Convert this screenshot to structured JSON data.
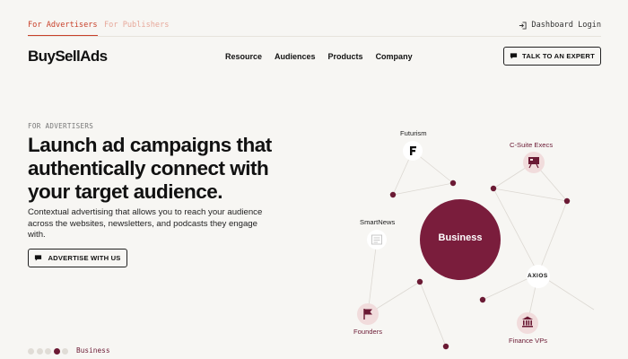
{
  "topbar": {
    "tab_advertisers": "For Advertisers",
    "tab_publishers": "For Publishers",
    "login": "Dashboard Login"
  },
  "nav": {
    "logo": "BuySellAds",
    "items": [
      "Resource",
      "Audiences",
      "Products",
      "Company"
    ],
    "talk_button": "TALK TO AN EXPERT"
  },
  "hero": {
    "eyebrow": "FOR ADVERTISERS",
    "headline": "Launch ad campaigns that authentically connect with your target audience.",
    "subtext": "Contextual advertising that allows you to reach your audience across the websites, newsletters, and podcasts they engage with.",
    "cta": "ADVERTISE WITH US"
  },
  "pager": {
    "dots": 5,
    "active_index": 3,
    "label": "Business"
  },
  "diagram": {
    "center": "Business",
    "nodes": {
      "futurism": "Futurism",
      "csuite": "C-Suite Execs",
      "smartnews": "SmartNews",
      "axios": "AXIOS",
      "founders": "Founders",
      "financevps": "Finance VPs"
    },
    "colors": {
      "wine": "#6b1a34",
      "center_fill": "#7a1d3c",
      "pale_circle": "#f1dcdc",
      "line": "#dcd8d2"
    }
  }
}
